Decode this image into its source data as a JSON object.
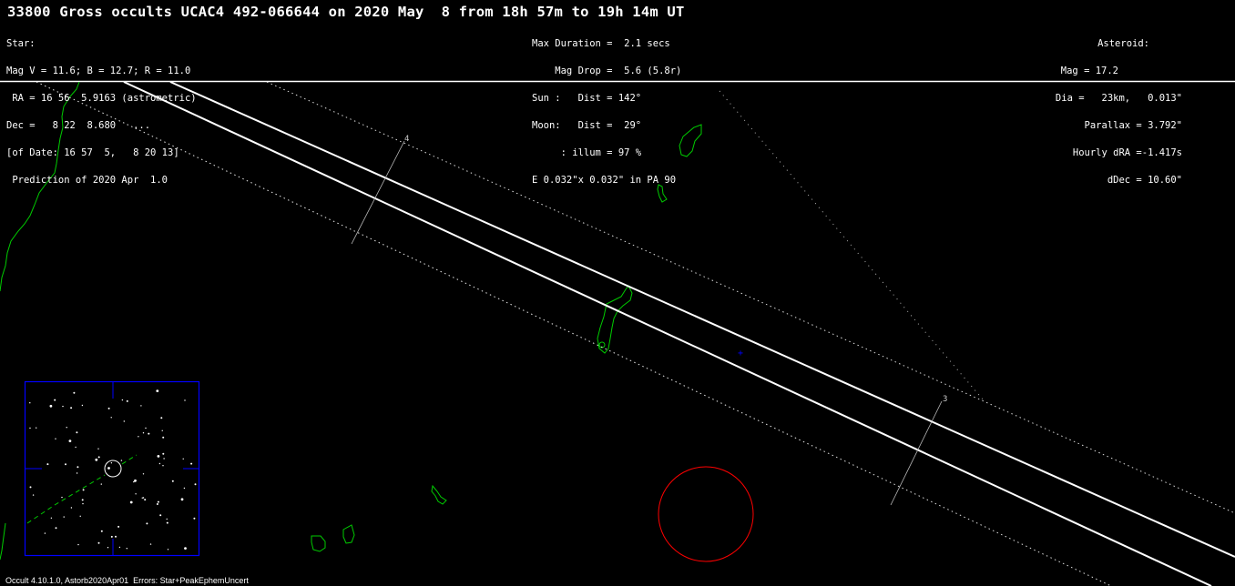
{
  "header": {
    "title": "33800 Gross occults UCAC4 492-066644 on 2020 May  8 from 18h 57m to 19h 14m UT"
  },
  "star_block": {
    "lines": [
      "Star:",
      "Mag V = 11.6; B = 12.7; R = 11.0",
      " RA = 16 56  5.9163 (astrometric)",
      "Dec =   8 22  8.680   ...",
      "[of Date: 16 57  5,   8 20 13]",
      " Prediction of 2020 Apr  1.0"
    ]
  },
  "event_block": {
    "lines": [
      "Max Duration =  2.1 secs",
      "    Mag Drop =  5.6 (5.8r)",
      "Sun :   Dist = 142°",
      "Moon:   Dist =  29°",
      "     : illum = 97 %",
      "E 0.032\"x 0.032\" in PA 90"
    ]
  },
  "asteroid_block": {
    "lines": [
      "Asteroid:",
      "Mag = 17.2",
      "Dia =   23km,   0.013\"",
      "Parallax = 3.792\"",
      "Hourly dRA =-1.417s",
      "dDec = 10.60\""
    ]
  },
  "map": {
    "time_marks": [
      "4",
      "3"
    ],
    "colors": {
      "background": "#000000",
      "path_lines": "#ffffff",
      "coastline": "#00cc00",
      "moon_circle": "#ff0000",
      "finder_frame": "#0000ff",
      "center_mark": "#0000ff"
    }
  },
  "footer": {
    "text": "Occult 4.10.1.0, Astorb2020Apr01  Errors: Star+PeakEphemUncert"
  }
}
